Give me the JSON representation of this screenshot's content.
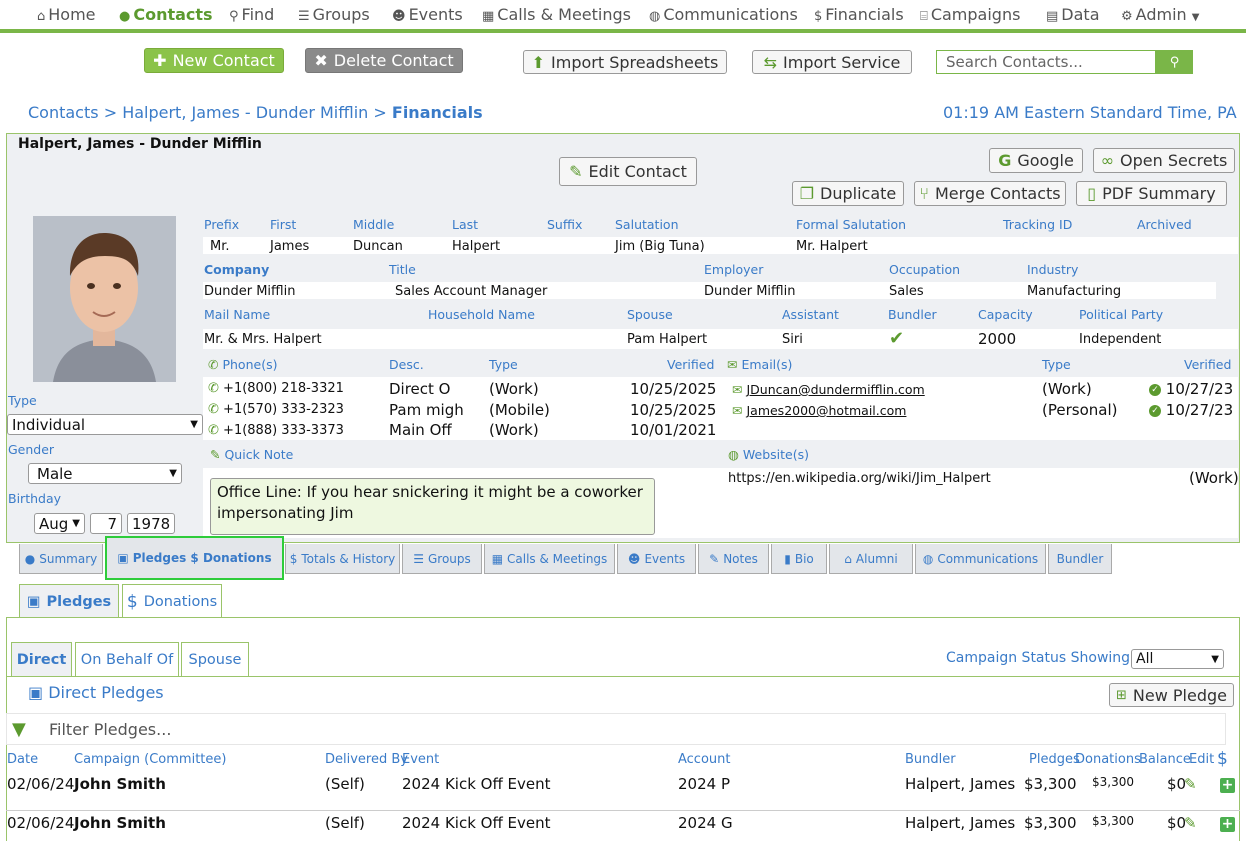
{
  "nav": {
    "items": [
      {
        "icon": "home-icon",
        "glyph": "⌂",
        "label": "Home"
      },
      {
        "icon": "person-icon",
        "glyph": "●",
        "label": "Contacts"
      },
      {
        "icon": "search-icon",
        "glyph": "⚲",
        "label": "Find"
      },
      {
        "icon": "list-icon",
        "glyph": "☰",
        "label": "Groups"
      },
      {
        "icon": "people-icon",
        "glyph": "☻",
        "label": "Events"
      },
      {
        "icon": "calendar-icon",
        "glyph": "▦",
        "label": "Calls & Meetings"
      },
      {
        "icon": "globe-icon",
        "glyph": "◍",
        "label": "Communications"
      },
      {
        "icon": "dollar-icon",
        "glyph": "$",
        "label": "Financials"
      },
      {
        "icon": "bank-icon",
        "glyph": "⌸",
        "label": "Campaigns"
      },
      {
        "icon": "table-icon",
        "glyph": "▤",
        "label": "Data"
      },
      {
        "icon": "gears-icon",
        "glyph": "⚙",
        "label": "Admin"
      }
    ],
    "active": "Contacts"
  },
  "toolbar": {
    "new_contact": "New Contact",
    "delete_contact": "Delete Contact",
    "import_spreadsheets": "Import Spreadsheets",
    "import_service": "Import Service",
    "search_placeholder": "Search Contacts..."
  },
  "breadcrumb": {
    "root": "Contacts",
    "sep1": ">",
    "contact": "Halpert, James - Dunder Mifflin",
    "sep2": ">",
    "current": "Financials"
  },
  "clock": "01:19 AM Eastern Standard Time, PA",
  "contact": {
    "name": "Halpert, James - Dunder Mifflin",
    "buttons": {
      "edit": "Edit Contact",
      "google": "Google",
      "secrets": "Open Secrets",
      "duplicate": "Duplicate",
      "merge": "Merge Contacts",
      "pdf": "PDF Summary"
    },
    "labels": {
      "prefix": "Prefix",
      "first": "First",
      "middle": "Middle",
      "last": "Last",
      "suffix": "Suffix",
      "salutation": "Salutation",
      "formal": "Formal Salutation",
      "tracking": "Tracking ID",
      "archived": "Archived",
      "company": "Company",
      "title": "Title",
      "employer": "Employer",
      "occupation": "Occupation",
      "industry": "Industry",
      "mail_name": "Mail Name",
      "household": "Household Name",
      "spouse": "Spouse",
      "assistant": "Assistant",
      "bundler": "Bundler",
      "capacity": "Capacity",
      "party": "Political Party",
      "phones": "Phone(s)",
      "desc": "Desc.",
      "type": "Type",
      "verified": "Verified",
      "emails": "Email(s)",
      "etype": "Type",
      "everified": "Verified",
      "quick_note": "Quick Note",
      "websites": "Website(s)",
      "type_field": "Type",
      "gender": "Gender",
      "birthday": "Birthday"
    },
    "values": {
      "prefix": "Mr.",
      "first": "James",
      "middle": "Duncan",
      "last": "Halpert",
      "salutation": "Jim (Big Tuna)",
      "formal": "Mr. Halpert",
      "company": "Dunder Mifflin",
      "title": "Sales Account Manager",
      "employer": "Dunder Mifflin",
      "occupation": "Sales",
      "industry": "Manufacturing",
      "mail_name": "Mr. & Mrs. Halpert",
      "spouse": "Pam Halpert",
      "assistant": "Siri",
      "capacity": "2000",
      "party": "Independent",
      "type_field": "Individual",
      "gender": "Male",
      "bday_month": "Aug",
      "bday_day": "7",
      "bday_year": "1978",
      "quick_note": "Office Line: If you hear snickering it might be a coworker impersonating Jim",
      "website": "https://en.wikipedia.org/wiki/Jim_Halpert",
      "website_type": "(Work)"
    },
    "phones": [
      {
        "number": "+1(800) 218-3321",
        "desc": "Direct O",
        "type": "(Work)",
        "verified": "10/25/2025"
      },
      {
        "number": "+1(570) 333-2323",
        "desc": "Pam migh",
        "type": "(Mobile)",
        "verified": "10/25/2025"
      },
      {
        "number": "+1(888) 333-3373",
        "desc": "Main Off",
        "type": "(Work)",
        "verified": "10/01/2021"
      }
    ],
    "emails": [
      {
        "address": "JDuncan@dundermifflin.com",
        "type": "(Work)",
        "verified": "10/27/23"
      },
      {
        "address": "James2000@hotmail.com",
        "type": "(Personal)",
        "verified": "10/27/23"
      }
    ]
  },
  "tabs": [
    {
      "icon": "person-icon",
      "glyph": "●",
      "label": "Summary"
    },
    {
      "icon": "money-icon",
      "glyph": "▣",
      "label": "Pledges $ Donations"
    },
    {
      "icon": "dollar-icon",
      "glyph": "$",
      "label": "Totals & History"
    },
    {
      "icon": "list-icon",
      "glyph": "☰",
      "label": "Groups"
    },
    {
      "icon": "calendar-icon",
      "glyph": "▦",
      "label": "Calls & Meetings"
    },
    {
      "icon": "people-icon",
      "glyph": "☻",
      "label": "Events"
    },
    {
      "icon": "edit-icon",
      "glyph": "✎",
      "label": "Notes"
    },
    {
      "icon": "book-icon",
      "glyph": "▮",
      "label": "Bio"
    },
    {
      "icon": "graduation-icon",
      "glyph": "⌂",
      "label": "Alumni"
    },
    {
      "icon": "globe-icon",
      "glyph": "◍",
      "label": "Communications"
    },
    {
      "icon": "",
      "glyph": "",
      "label": "Bundler"
    }
  ],
  "subtabs": {
    "pledges": "Pledges",
    "donations": "Donations"
  },
  "pledge_tabs": {
    "direct": "Direct",
    "behalf": "On Behalf Of",
    "spouse": "Spouse"
  },
  "campaign_status": {
    "label": "Campaign Status Showing:",
    "value": "All"
  },
  "direct_pledges": {
    "title": "Direct Pledges",
    "new_pledge": "New Pledge",
    "filter_placeholder": "Filter Pledges..."
  },
  "table": {
    "headers": {
      "date": "Date",
      "campaign": "Campaign (Committee)",
      "delivered": "Delivered By",
      "event": "Event",
      "account": "Account",
      "bundler": "Bundler",
      "pledges": "Pledges",
      "donations": "Donations",
      "balance": "Balance",
      "edit": "Edit",
      "dollar": "$"
    },
    "rows": [
      {
        "date": "02/06/24",
        "campaign": "John Smith",
        "delivered": "(Self)",
        "event": "2024 Kick Off Event",
        "account": "2024 P",
        "bundler": "Halpert, James",
        "pledges": "$3,300",
        "donations": "$3,300",
        "balance": "$0"
      },
      {
        "date": "02/06/24",
        "campaign": "John Smith",
        "delivered": "(Self)",
        "event": "2024 Kick Off Event",
        "account": "2024 G",
        "bundler": "Halpert, James",
        "pledges": "$3,300",
        "donations": "$3,300",
        "balance": "$0"
      }
    ]
  }
}
